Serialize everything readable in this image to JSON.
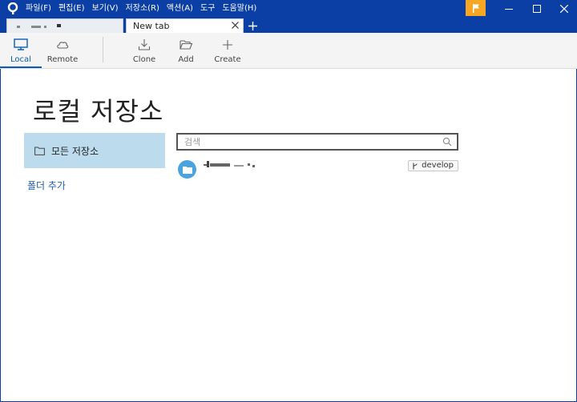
{
  "menu": {
    "items": [
      "파일(F)",
      "편집(E)",
      "보기(V)",
      "저장소(R)",
      "액션(A)",
      "도구",
      "도움말(H)"
    ]
  },
  "tabs": {
    "new_tab_label": "New tab"
  },
  "toolbar": {
    "local_label": "Local",
    "remote_label": "Remote",
    "clone_label": "Clone",
    "add_label": "Add",
    "create_label": "Create"
  },
  "main": {
    "title": "로컬 저장소",
    "nav_all_repos": "모든 저장소",
    "add_folder": "폴더 추가",
    "search_placeholder": "검색",
    "repos": [
      {
        "branch": "develop"
      }
    ]
  },
  "colors": {
    "titlebar": "#0b3fa5",
    "accent": "#0b5cb5",
    "flag": "#f5a623",
    "selected_nav": "#bcdcee",
    "repo_icon": "#4aa3df"
  }
}
